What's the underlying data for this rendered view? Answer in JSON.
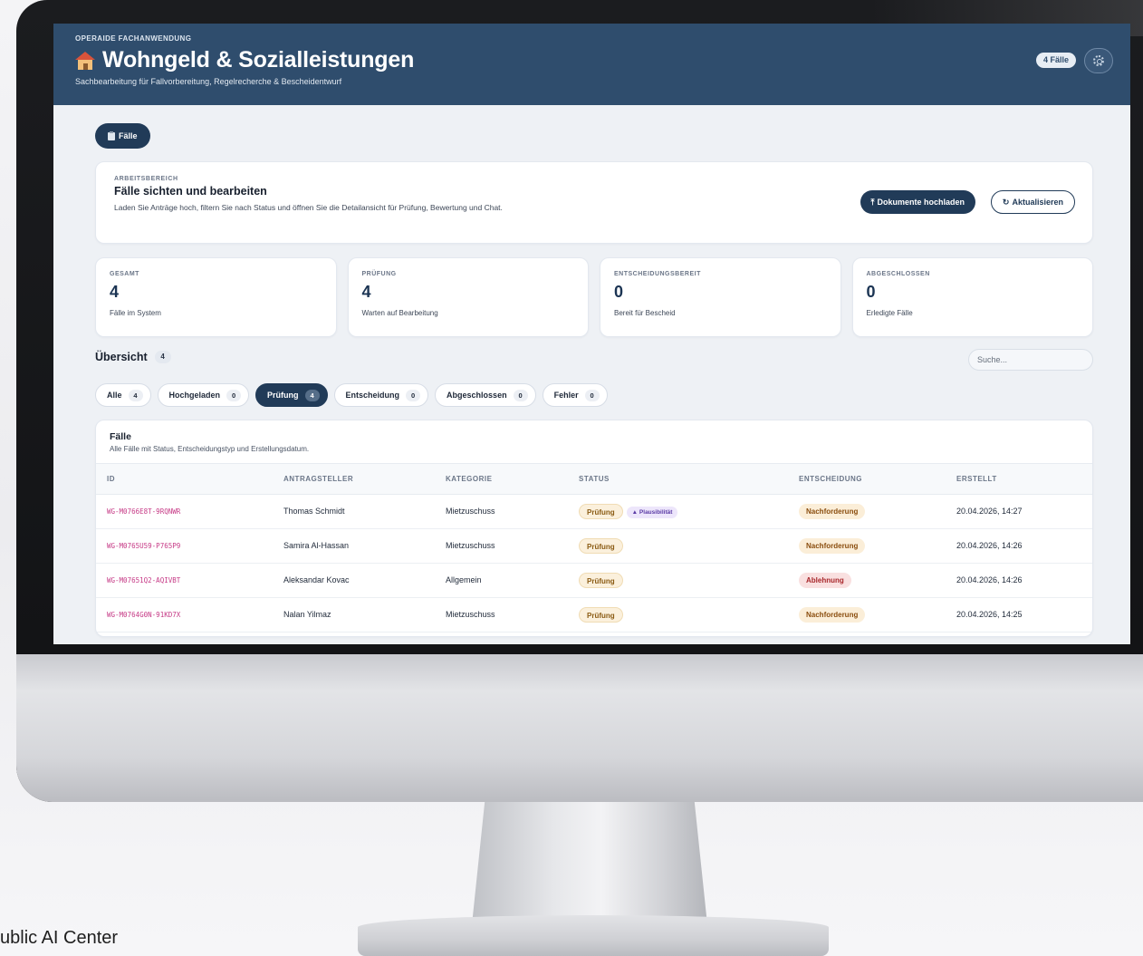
{
  "header": {
    "eyebrow": "OPERAIDE FACHANWENDUNG",
    "title": "Wohngeld & Sozialleistungen",
    "subtitle": "Sachbearbeitung für Fallvorbereitung, Regelrecherche & Bescheidentwurf",
    "case_count": "4 Fälle",
    "colors": {
      "header_bg": "#2f4d6d",
      "primary": "#213b58"
    }
  },
  "nav": {
    "cases_tab": "Fälle",
    "cases_icon": "clipboard-icon"
  },
  "workspace": {
    "eyebrow": "ARBEITSBEREICH",
    "title": "Fälle sichten und bearbeiten",
    "description": "Laden Sie Anträge hoch, filtern Sie nach Status und öffnen Sie die Detailansicht für Prüfung, Bewertung und Chat.",
    "upload_button": "Dokumente hochladen",
    "refresh_button": "Aktualisieren"
  },
  "stats": [
    {
      "label": "GESAMT",
      "value": "4",
      "sub": "Fälle im System"
    },
    {
      "label": "PRÜFUNG",
      "value": "4",
      "sub": "Warten auf Bearbeitung"
    },
    {
      "label": "ENTSCHEIDUNGSBEREIT",
      "value": "0",
      "sub": "Bereit für Bescheid"
    },
    {
      "label": "ABGESCHLOSSEN",
      "value": "0",
      "sub": "Erledigte Fälle"
    }
  ],
  "overview": {
    "title": "Übersicht",
    "count": "4",
    "search_placeholder": "Suche..."
  },
  "filters": [
    {
      "label": "Alle",
      "count": "4",
      "active": false
    },
    {
      "label": "Hochgeladen",
      "count": "0",
      "active": false
    },
    {
      "label": "Prüfung",
      "count": "4",
      "active": true
    },
    {
      "label": "Entscheidung",
      "count": "0",
      "active": false
    },
    {
      "label": "Abgeschlossen",
      "count": "0",
      "active": false
    },
    {
      "label": "Fehler",
      "count": "0",
      "active": false
    }
  ],
  "table": {
    "title": "Fälle",
    "description": "Alle Fälle mit Status, Entscheidungstyp und Erstellungsdatum.",
    "columns": [
      "ID",
      "ANTRAGSTELLER",
      "KATEGORIE",
      "STATUS",
      "ENTSCHEIDUNG",
      "ERSTELLT"
    ],
    "rows": [
      {
        "id": "WG-M0766E8T-9RQNWR",
        "applicant": "Thomas Schmidt",
        "category": "Mietzuschuss",
        "status": "Prüfung",
        "flag": "Plausibilität",
        "decision": "Nachforderung",
        "decision_type": "nachforderung",
        "created": "20.04.2026, 14:27"
      },
      {
        "id": "WG-M0765U59-P765P9",
        "applicant": "Samira Al-Hassan",
        "category": "Mietzuschuss",
        "status": "Prüfung",
        "flag": "",
        "decision": "Nachforderung",
        "decision_type": "nachforderung",
        "created": "20.04.2026, 14:26"
      },
      {
        "id": "WG-M07651Q2-AQIVBT",
        "applicant": "Aleksandar Kovac",
        "category": "Allgemein",
        "status": "Prüfung",
        "flag": "",
        "decision": "Ablehnung",
        "decision_type": "ablehnung",
        "created": "20.04.2026, 14:26"
      },
      {
        "id": "WG-M0764G0N-91KD7X",
        "applicant": "Nalan Yilmaz",
        "category": "Mietzuschuss",
        "status": "Prüfung",
        "flag": "",
        "decision": "Nachforderung",
        "decision_type": "nachforderung",
        "created": "20.04.2026, 14:25"
      }
    ]
  },
  "caption": "ublic AI Center"
}
